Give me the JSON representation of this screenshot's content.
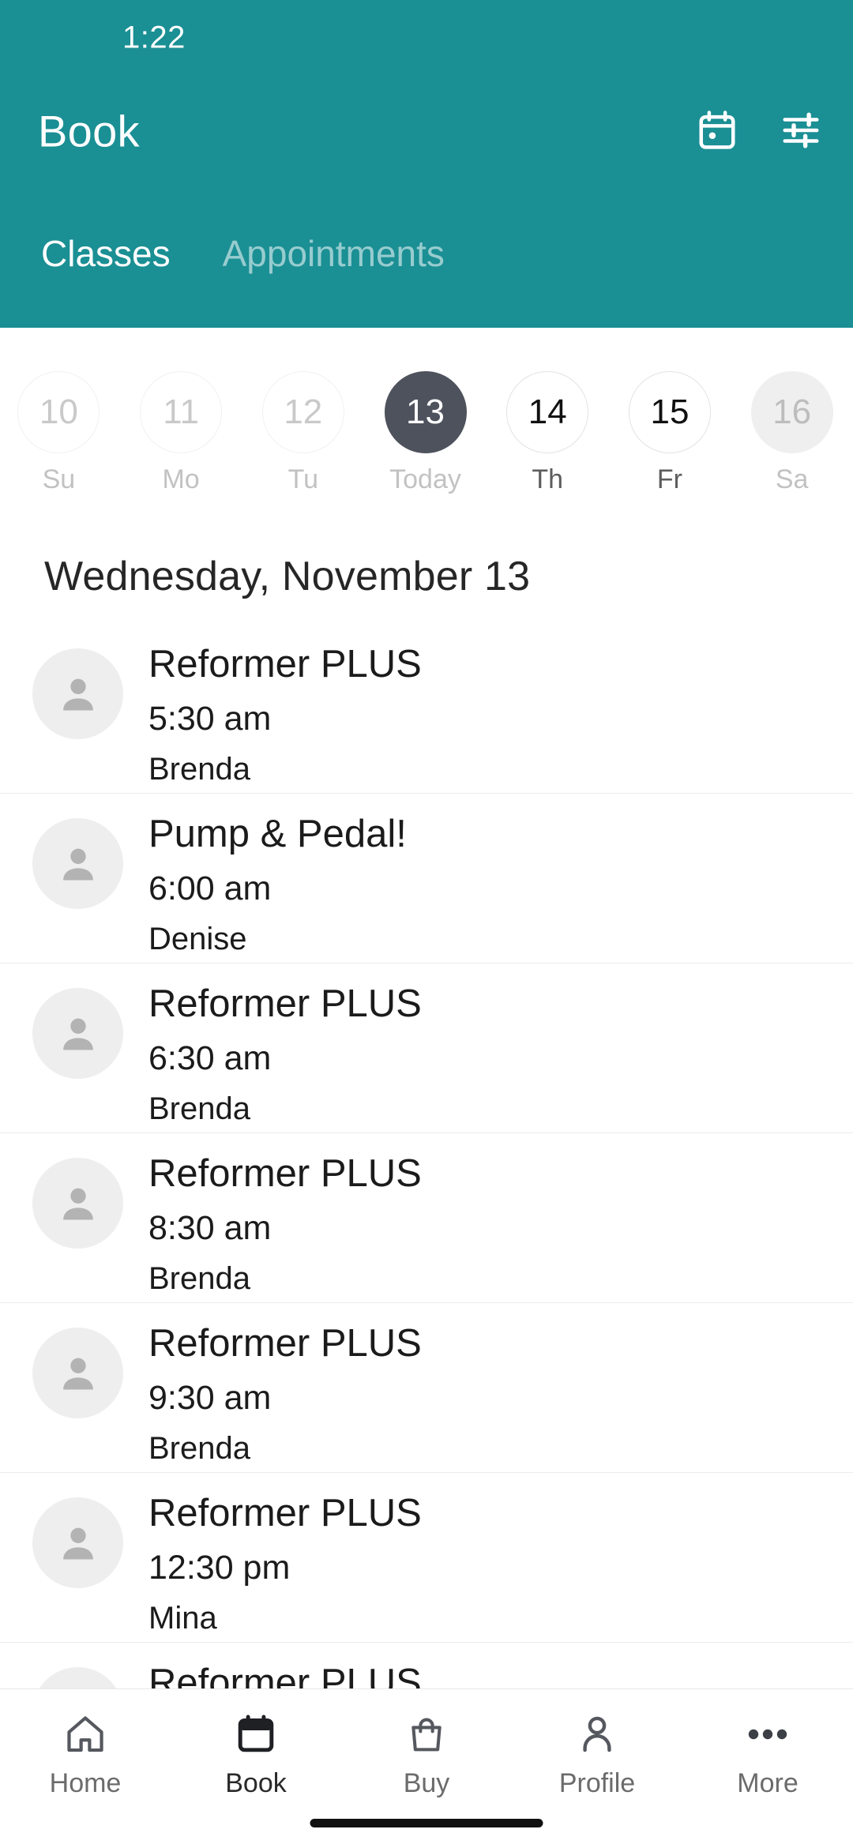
{
  "theme": {
    "teal": "#1a8f94",
    "selected_date_bg": "#4e525d",
    "text_dark": "#1b1b1b",
    "muted": "#c2c2c2"
  },
  "status_bar": {
    "time": "1:22"
  },
  "header": {
    "title": "Book",
    "actions": [
      {
        "name": "calendar-icon",
        "label": "Calendar"
      },
      {
        "name": "filter-icon",
        "label": "Filters"
      }
    ],
    "tabs": [
      {
        "label": "Classes",
        "active": true
      },
      {
        "label": "Appointments",
        "active": false
      }
    ]
  },
  "date_strip": [
    {
      "day": "10",
      "weekday": "Su",
      "state": "past"
    },
    {
      "day": "11",
      "weekday": "Mo",
      "state": "past"
    },
    {
      "day": "12",
      "weekday": "Tu",
      "state": "past"
    },
    {
      "day": "13",
      "weekday": "Today",
      "state": "selected"
    },
    {
      "day": "14",
      "weekday": "Th",
      "state": "future"
    },
    {
      "day": "15",
      "weekday": "Fr",
      "state": "future"
    },
    {
      "day": "16",
      "weekday": "Sa",
      "state": "dim"
    }
  ],
  "day_heading": "Wednesday, November 13",
  "classes": [
    {
      "title": "Reformer PLUS",
      "time": "5:30 am",
      "instructor": "Brenda"
    },
    {
      "title": "Pump & Pedal!",
      "time": "6:00 am",
      "instructor": "Denise"
    },
    {
      "title": "Reformer PLUS",
      "time": "6:30 am",
      "instructor": "Brenda"
    },
    {
      "title": "Reformer PLUS",
      "time": "8:30 am",
      "instructor": "Brenda"
    },
    {
      "title": "Reformer PLUS",
      "time": "9:30 am",
      "instructor": "Brenda"
    },
    {
      "title": "Reformer PLUS",
      "time": "12:30 pm",
      "instructor": "Mina"
    },
    {
      "title": "Reformer PLUS",
      "time": "",
      "instructor": ""
    }
  ],
  "bottom_nav": [
    {
      "label": "Home",
      "icon": "home-icon",
      "active": false
    },
    {
      "label": "Book",
      "icon": "calendar-icon",
      "active": true
    },
    {
      "label": "Buy",
      "icon": "bag-icon",
      "active": false
    },
    {
      "label": "Profile",
      "icon": "person-icon",
      "active": false
    },
    {
      "label": "More",
      "icon": "ellipsis-icon",
      "active": false
    }
  ]
}
